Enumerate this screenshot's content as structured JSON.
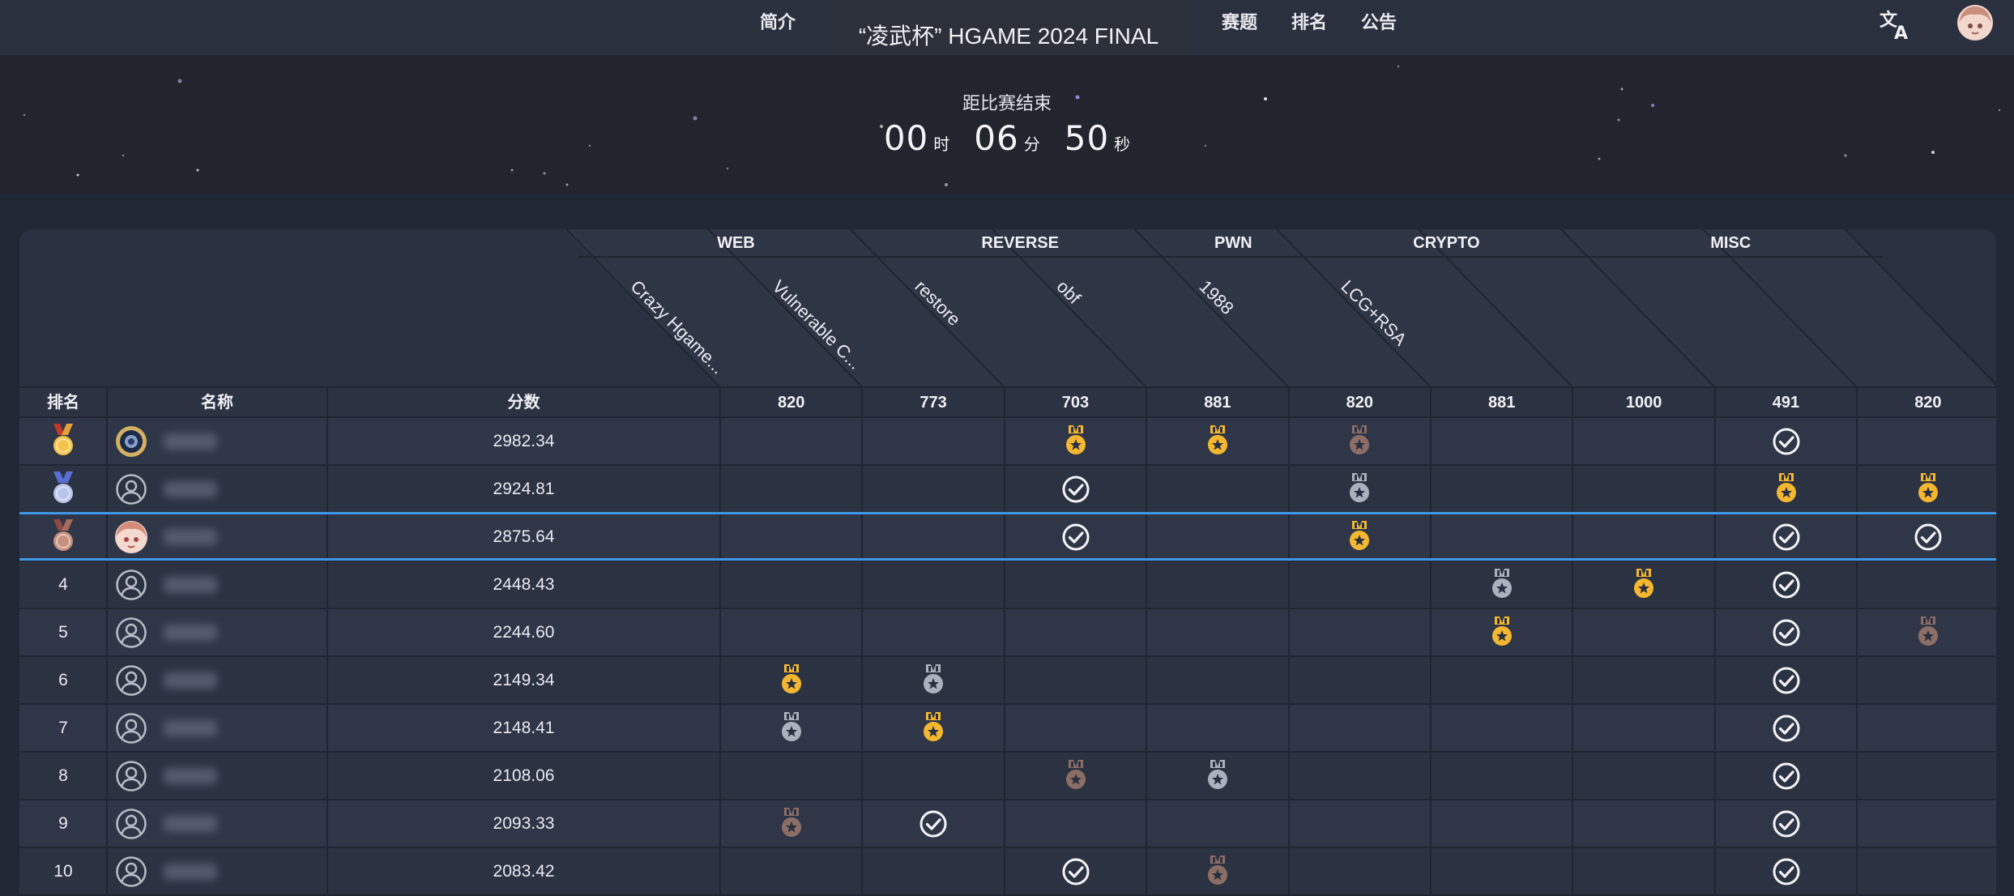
{
  "nav": {
    "left_items": [
      {
        "label": "简介"
      }
    ],
    "right_items": [
      {
        "label": "赛题"
      },
      {
        "label": "排名"
      },
      {
        "label": "公告"
      }
    ],
    "title": "“凌武杯” HGAME 2024 FINAL",
    "translate_icon": "translate-icon",
    "avatar_icon": "user-avatar"
  },
  "countdown": {
    "label": "距比赛结束",
    "hours": "00",
    "hours_unit": "时",
    "minutes": "06",
    "minutes_unit": "分",
    "seconds": "50",
    "seconds_unit": "秒"
  },
  "scoreboard": {
    "categories": [
      {
        "name": "WEB",
        "span": 2
      },
      {
        "name": "REVERSE",
        "span": 2
      },
      {
        "name": "PWN",
        "span": 1
      },
      {
        "name": "CRYPTO",
        "span": 2
      },
      {
        "name": "MISC",
        "span": 2
      }
    ],
    "challenges": [
      {
        "name": "Crazy Hgame...",
        "points": "820"
      },
      {
        "name": "Vulnerable C...",
        "points": "773"
      },
      {
        "name": "restore",
        "points": "703"
      },
      {
        "name": "obf",
        "points": "881"
      },
      {
        "name": "1988",
        "points": "820"
      },
      {
        "name": "LCG+RSA",
        "points": "881"
      },
      {
        "name": "",
        "points": "1000"
      },
      {
        "name": "",
        "points": "491"
      },
      {
        "name": "",
        "points": "820"
      }
    ],
    "headers": {
      "rank": "排名",
      "name": "名称",
      "score": "分数"
    },
    "rows": [
      {
        "rank": "1",
        "rank_icon": "gold-medal-icon",
        "avatar": "team-logo",
        "score": "2982.34",
        "cells": [
          "",
          "",
          "gold",
          "gold",
          "bronze",
          "",
          "",
          "solved",
          ""
        ],
        "selected": false
      },
      {
        "rank": "2",
        "rank_icon": "silver-medal-icon",
        "avatar": "default",
        "score": "2924.81",
        "cells": [
          "",
          "",
          "solved",
          "",
          "silver",
          "",
          "",
          "gold",
          "gold"
        ],
        "selected": false
      },
      {
        "rank": "3",
        "rank_icon": "bronze-medal-icon",
        "avatar": "anime",
        "score": "2875.64",
        "cells": [
          "",
          "",
          "solved",
          "",
          "gold",
          "",
          "",
          "solved",
          "solved"
        ],
        "selected": true
      },
      {
        "rank": "4",
        "rank_icon": "",
        "avatar": "default",
        "score": "2448.43",
        "cells": [
          "",
          "",
          "",
          "",
          "",
          "silver",
          "gold",
          "solved",
          ""
        ],
        "selected": false
      },
      {
        "rank": "5",
        "rank_icon": "",
        "avatar": "default",
        "score": "2244.60",
        "cells": [
          "",
          "",
          "",
          "",
          "",
          "gold",
          "",
          "solved",
          "bronze"
        ],
        "selected": false
      },
      {
        "rank": "6",
        "rank_icon": "",
        "avatar": "default",
        "score": "2149.34",
        "cells": [
          "gold",
          "silver",
          "",
          "",
          "",
          "",
          "",
          "solved",
          ""
        ],
        "selected": false
      },
      {
        "rank": "7",
        "rank_icon": "",
        "avatar": "default",
        "score": "2148.41",
        "cells": [
          "silver",
          "gold",
          "",
          "",
          "",
          "",
          "",
          "solved",
          ""
        ],
        "selected": false
      },
      {
        "rank": "8",
        "rank_icon": "",
        "avatar": "default",
        "score": "2108.06",
        "cells": [
          "",
          "",
          "bronze",
          "silver",
          "",
          "",
          "",
          "solved",
          ""
        ],
        "selected": false
      },
      {
        "rank": "9",
        "rank_icon": "",
        "avatar": "default",
        "score": "2093.33",
        "cells": [
          "bronze",
          "solved",
          "",
          "",
          "",
          "",
          "",
          "solved",
          ""
        ],
        "selected": false
      },
      {
        "rank": "10",
        "rank_icon": "",
        "avatar": "default",
        "score": "2083.42",
        "cells": [
          "",
          "",
          "solved",
          "bronze",
          "",
          "",
          "",
          "solved",
          ""
        ],
        "selected": false
      }
    ]
  },
  "colors": {
    "gold": "#f5b730",
    "silver": "#aab3bd",
    "bronze": "#8c6e66",
    "highlight": "#3d98e6"
  }
}
